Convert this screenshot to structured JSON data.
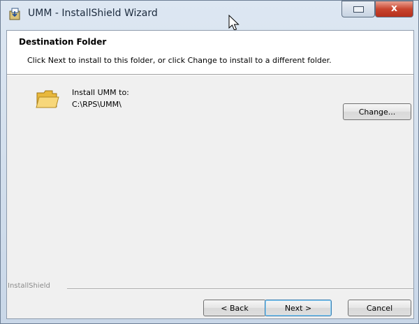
{
  "window": {
    "title": "UMM - InstallShield Wizard",
    "title_icon": "installer-icon",
    "controls": {
      "restore_icon": "restore-icon",
      "close_glyph": "x"
    }
  },
  "header": {
    "title": "Destination Folder",
    "subtitle": "Click Next to install to this folder, or click Change to install to a different folder."
  },
  "destination": {
    "icon": "folder-icon",
    "label": "Install UMM to:",
    "path": "C:\\RPS\\UMM\\",
    "change_label": "Change..."
  },
  "footer": {
    "brand": "InstallShield",
    "back_label": "< Back",
    "next_label": "Next >",
    "cancel_label": "Cancel"
  },
  "colors": {
    "frame": "#c9d7e8",
    "client": "#f0f0f0",
    "close_red": "#c8452f",
    "default_button_border": "#3c7fb1"
  }
}
